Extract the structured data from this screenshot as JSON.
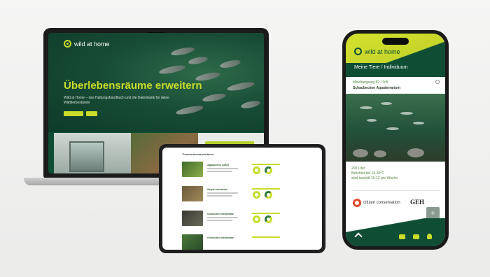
{
  "laptop": {
    "brand": "wild at home",
    "hero_title": "Überlebensräume erweitern",
    "hero_subtitle": "Wild at Home – das Haltungshandbuch und die Datenbank für deine Wildtierbestände",
    "buttons": [
      "",
      ""
    ]
  },
  "tablet": {
    "title": "Tierartenbestandsdaten",
    "rows": [
      {
        "name": "Agapornis rufipi"
      },
      {
        "name": "Sepia sineraria"
      },
      {
        "name": "Gobiodon okinawae"
      },
      {
        "name": "Gobiodon okinawae"
      }
    ]
  },
  "phone": {
    "brand": "wild at home",
    "nav_title": "Meine Tiere / Individuum",
    "sub_location": "Mittelbergweg 82 / 1rB",
    "sub_title": "Schaubecken Aquaterrarium",
    "info_text": "200 Liter\nBelichtet bei 15-30°C\nwird bestellt 10-12 pro Woche",
    "logo_cc": "citizen conservation",
    "logo_geh": "GEH",
    "fab": "+"
  },
  "colors": {
    "accent": "#c9dc2a",
    "brand_dark": "#0f4e35"
  }
}
